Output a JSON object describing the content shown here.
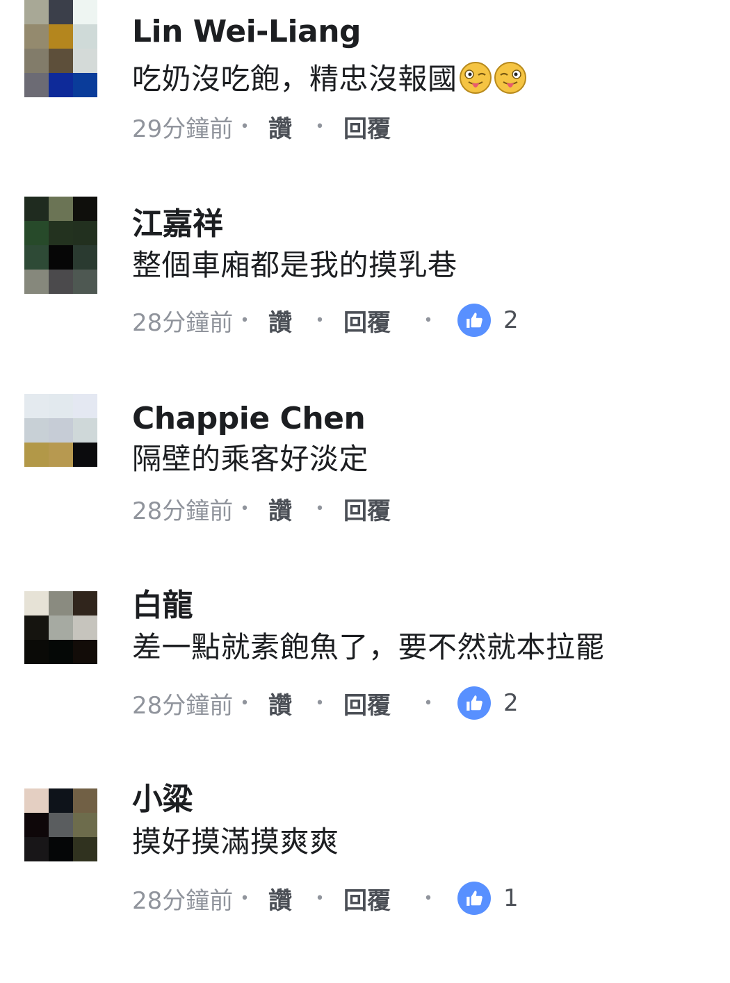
{
  "comments": [
    {
      "author": "Lin Wei-Liang",
      "text": "吃奶沒吃飽，精忠沒報國",
      "emojis": [
        "winking-tongue-emoji",
        "winking-tongue-emoji"
      ],
      "time": "29分鐘前",
      "like_label": "讚",
      "reply_label": "回覆",
      "reactions": null,
      "avatar_colors": [
        "#a8a896",
        "#3b3f4a",
        "#eef5f2",
        "#948a6e",
        "#b4861e",
        "#cfdad8",
        "#827c6a",
        "#5d4f3a",
        "#d4dad8",
        "#6c6b74",
        "#0e2a99",
        "#0a3c9a"
      ]
    },
    {
      "author": "江嘉祥",
      "text": "整個車廂都是我的摸乳巷",
      "emojis": [],
      "time": "28分鐘前",
      "like_label": "讚",
      "reply_label": "回覆",
      "reactions": "2",
      "avatar_colors": [
        "#1f2b1f",
        "#6b7455",
        "#0f0f0c",
        "#274a2a",
        "#23321f",
        "#22301f",
        "#2e4a36",
        "#060606",
        "#2a3a30",
        "#86887c",
        "#4b4a4c",
        "#4e5852"
      ]
    },
    {
      "author": "Chappie Chen",
      "text": "隔壁的乘客好淡定",
      "emojis": [],
      "time": "28分鐘前",
      "like_label": "讚",
      "reply_label": "回覆",
      "reactions": null,
      "avatar_colors": [
        "#e4eaef",
        "#e2e9ee",
        "#e4e8f2",
        "#c8d0d6",
        "#c6ccd6",
        "#cfd8d9",
        "#b29848",
        "#b79950",
        "#0b0b0d"
      ]
    },
    {
      "author": "白龍",
      "text": "差一點就素飽魚了，要不然就本拉罷",
      "emojis": [],
      "time": "28分鐘前",
      "like_label": "讚",
      "reply_label": "回覆",
      "reactions": "2",
      "avatar_colors": [
        "#e6e2d6",
        "#8a8b80",
        "#30251c",
        "#15140f",
        "#a6aaa2",
        "#c6c4bd",
        "#0a0a07",
        "#050806",
        "#120c08"
      ]
    },
    {
      "author": "小粱",
      "text": "摸好摸滿摸爽爽",
      "emojis": [],
      "time": "28分鐘前",
      "like_label": "讚",
      "reply_label": "回覆",
      "reactions": "1",
      "avatar_colors": [
        "#e4cfc2",
        "#0e131a",
        "#716045",
        "#0e0709",
        "#5a5d5f",
        "#6d6c4c",
        "#181618",
        "#050607",
        "#30321f"
      ]
    }
  ]
}
